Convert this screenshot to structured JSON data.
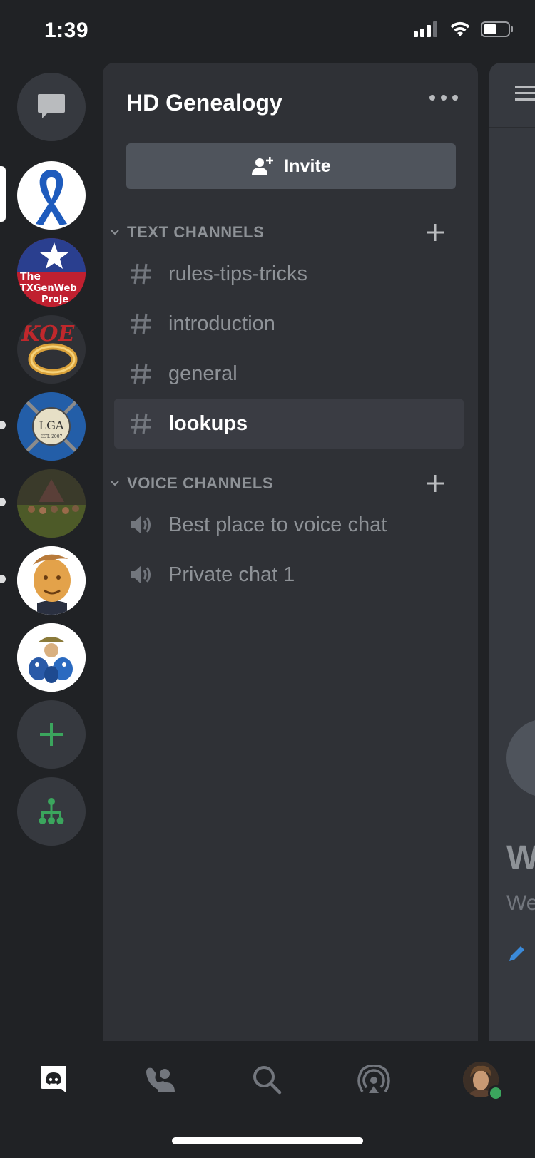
{
  "status_bar": {
    "time": "1:39"
  },
  "servers": [
    {
      "name": "blue-ribbon-server",
      "bg": "#ffffff"
    },
    {
      "name": "txgenweb-server",
      "text": "The TXGenWeb Proje"
    },
    {
      "name": "koe-ring-server",
      "text": "KOE"
    },
    {
      "name": "lga-server",
      "text": "LGA",
      "subtext": "EST. 2007"
    },
    {
      "name": "forest-gathering-server"
    },
    {
      "name": "cookie-face-server"
    },
    {
      "name": "blue-birds-server"
    }
  ],
  "panel": {
    "server_name": "HD Genealogy",
    "invite_label": "Invite",
    "text_category": "TEXT CHANNELS",
    "text_channels": [
      "rules-tips-tricks",
      "introduction",
      "general",
      "lookups"
    ],
    "active_channel": "lookups",
    "voice_category": "VOICE CHANNELS",
    "voice_channels": [
      "Best place to voice chat",
      "Private chat 1"
    ]
  },
  "peek": {
    "heading_fragment": "W",
    "text_fragment": "We"
  },
  "colors": {
    "rail_bg": "#202225",
    "panel_bg": "#2f3136",
    "accent_green": "#3ba55d",
    "muted_text": "#8e9297",
    "active_row": "#3a3c43"
  }
}
